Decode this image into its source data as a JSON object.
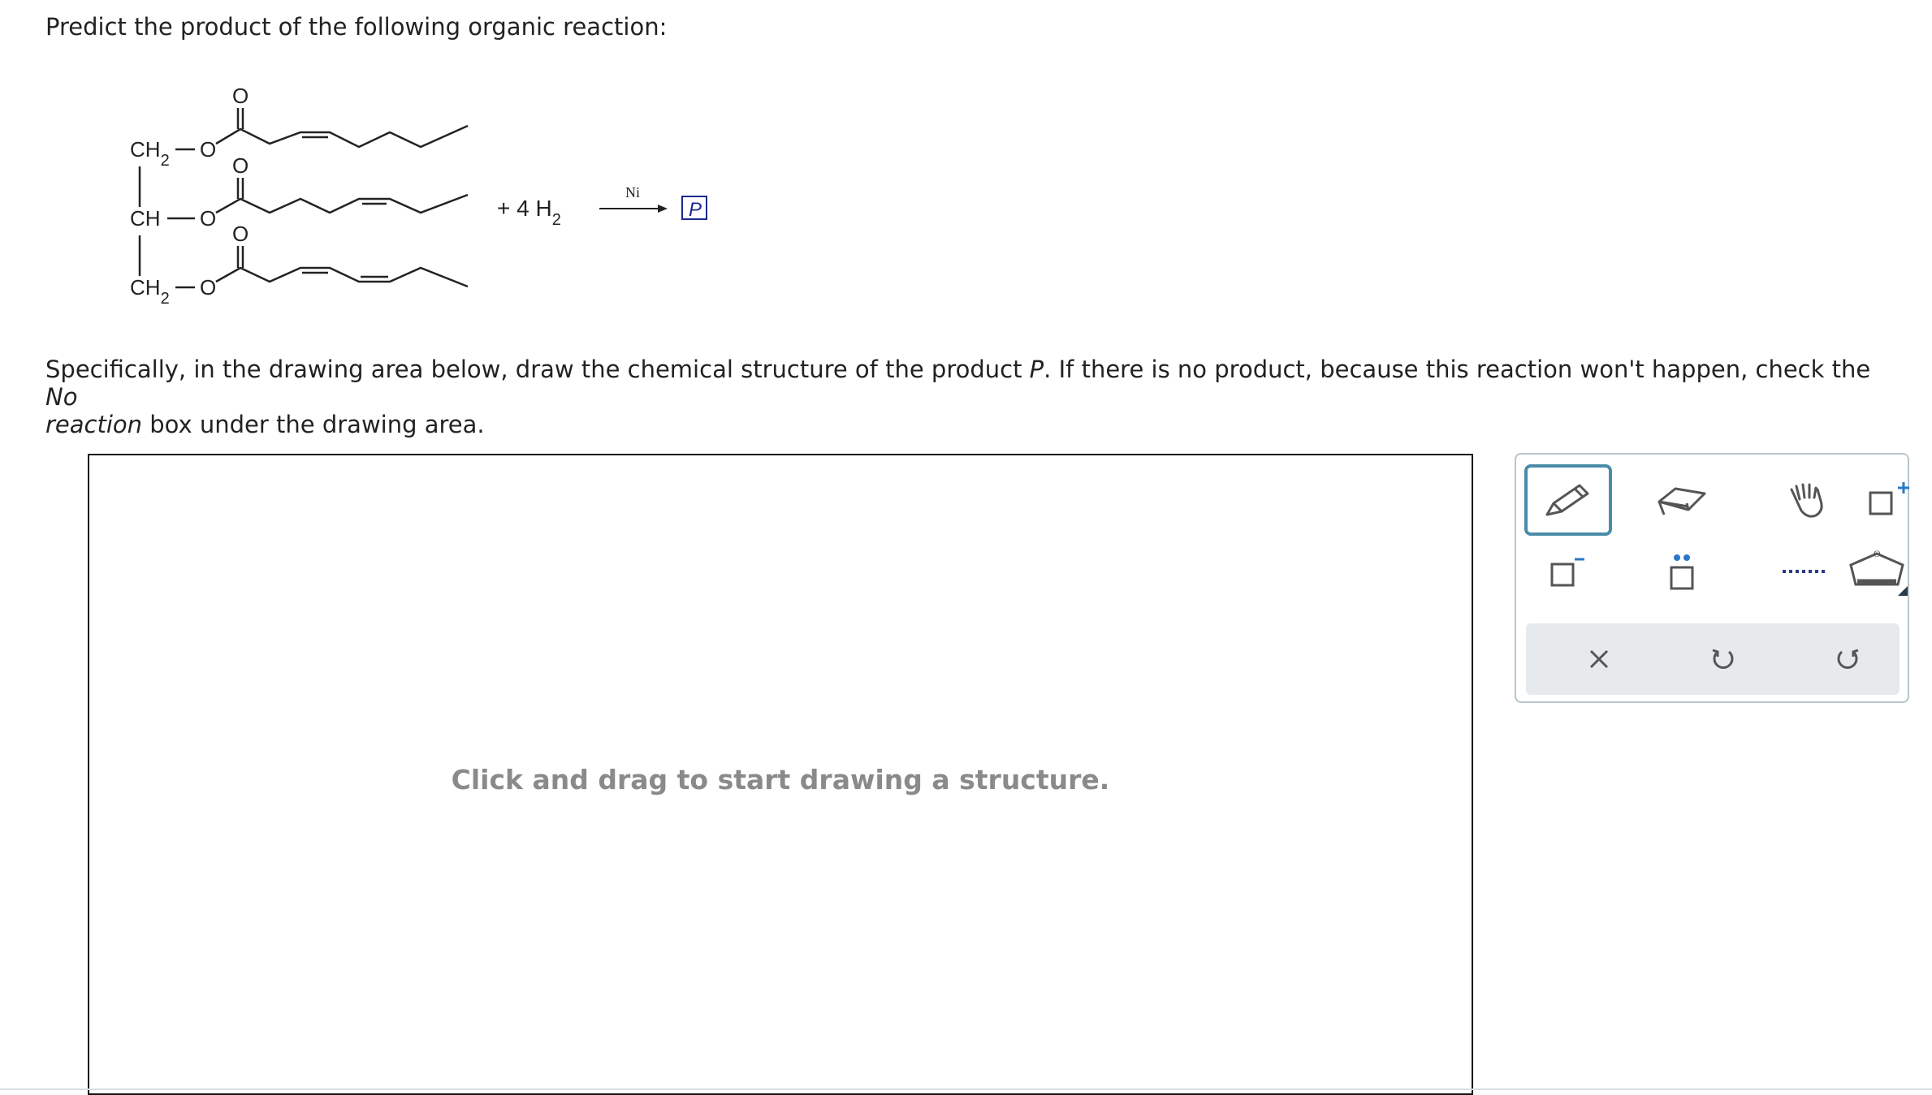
{
  "question": "Predict the product of the following organic reaction:",
  "reaction": {
    "glycerol_labels": [
      "CH2",
      "CH",
      "CH2"
    ],
    "ester_oxygen": "O",
    "carbonyl_oxygen": "O",
    "reagent": "+ 4 H2",
    "catalyst": "Ni",
    "product_label": "P"
  },
  "instructions": {
    "part1": "Specifically, in the drawing area below, draw the chemical structure of the product ",
    "product_italic": "P",
    "part2": ". If there is no product, because this reaction won't happen, check the ",
    "no_italic": "No",
    "line2_italic": "reaction",
    "part3": " box under the drawing area."
  },
  "canvas": {
    "hint": "Click and drag to start drawing a structure."
  },
  "toolbar": {
    "tools": [
      {
        "name": "pencil-tool",
        "icon": "pencil-icon",
        "active": true
      },
      {
        "name": "eraser-tool",
        "icon": "eraser-icon"
      },
      {
        "name": "hand-tool",
        "icon": "hand-icon"
      },
      {
        "name": "add-charge-tool",
        "icon": "positive-charge-icon"
      },
      {
        "name": "negative-charge-tool",
        "icon": "negative-charge-icon"
      },
      {
        "name": "lone-pair-tool",
        "icon": "lone-pair-icon"
      },
      {
        "name": "dashed-bond-tool",
        "icon": "dashed-bond-icon"
      },
      {
        "name": "template-tool",
        "icon": "ring-template-icon"
      }
    ],
    "actions": [
      {
        "name": "clear-button",
        "icon": "close-icon"
      },
      {
        "name": "undo-button",
        "icon": "undo-icon"
      },
      {
        "name": "redo-button",
        "icon": "redo-icon"
      }
    ],
    "accent_color": "#4a8ba8"
  },
  "colors": {
    "text": "#222222",
    "hint": "#8a8a8a",
    "product_box": "#1a2a8a",
    "action_bar": "#e6eaed"
  }
}
